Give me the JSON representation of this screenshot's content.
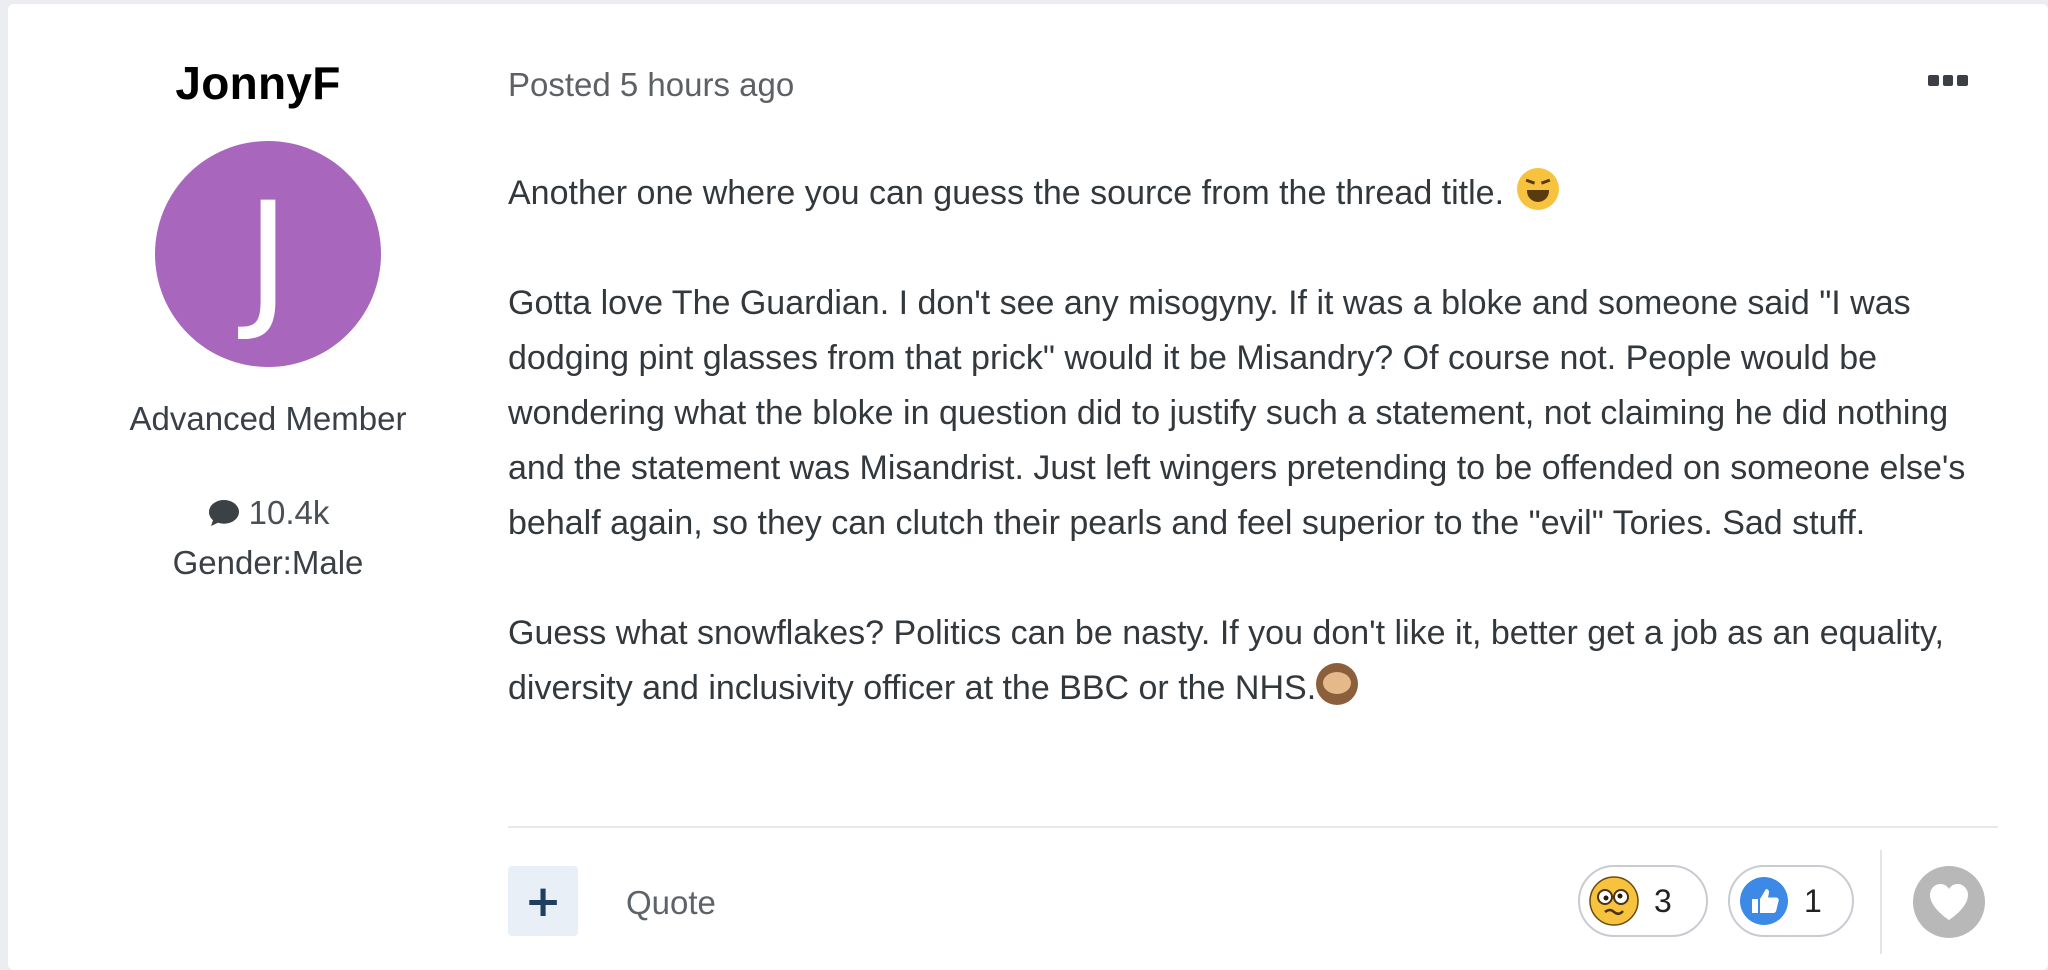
{
  "author": {
    "username": "JonnyF",
    "avatar_letter": "J",
    "avatar_color": "#a866bd",
    "rank": "Advanced Member",
    "post_count": "10.4k",
    "post_count_icon": "speech-bubble-icon",
    "gender": "Gender:Male"
  },
  "post": {
    "posted": "Posted 5 hours ago",
    "paragraphs": [
      "Another one where you can guess the source from the thread title.",
      "Gotta love The Guardian. I don't see any misogyny. If it was a bloke and someone said \"I was dodging pint glasses from that prick\" would it be Misandry? Of course not. People would be wondering what the bloke in question did to justify such a statement, not claiming he did nothing and the statement was Misandrist. Just left wingers pretending to be offended on someone else's behalf again, so they can clutch their pearls and feel superior to the \"evil\" Tories. Sad stuff.",
      "Guess what snowflakes? Politics can be nasty. If you don't like it, better get a job as an equality, diversity and inclusivity officer at the BBC or the NHS."
    ]
  },
  "actions": {
    "plus_label": "+",
    "quote_label": "Quote",
    "reactions": [
      {
        "icon": "confused-face-icon",
        "count": "3"
      },
      {
        "icon": "thumbs-up-icon",
        "count": "1"
      }
    ],
    "react_icon": "heart-icon"
  },
  "colors": {
    "accent_button_bg": "#e8eff7",
    "accent_button_fg": "#1e3f60",
    "like_blue": "#3d8ae6",
    "heart_gray": "#b8b8b8"
  }
}
